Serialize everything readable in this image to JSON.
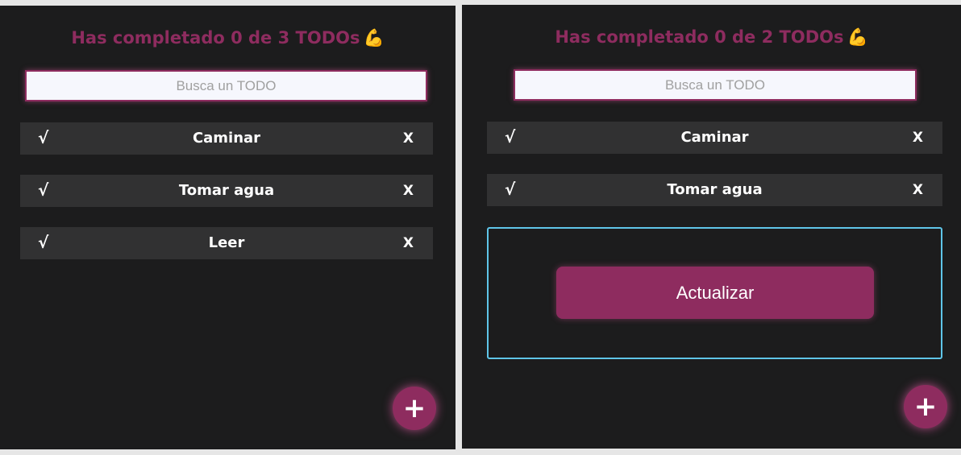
{
  "left": {
    "counter": "Has completado 0 de 3 TODOs",
    "counter_emoji": "💪",
    "search_placeholder": "Busca un TODO",
    "todos": [
      {
        "check": "√",
        "text": "Caminar",
        "delete": "X"
      },
      {
        "check": "√",
        "text": "Tomar agua",
        "delete": "X"
      },
      {
        "check": "√",
        "text": "Leer",
        "delete": "X"
      }
    ],
    "fab": "+"
  },
  "right": {
    "counter": "Has completado 0 de 2 TODOs",
    "counter_emoji": "💪",
    "search_placeholder": "Busca un TODO",
    "todos": [
      {
        "check": "√",
        "text": "Caminar",
        "delete": "X"
      },
      {
        "check": "√",
        "text": "Tomar agua",
        "delete": "X"
      }
    ],
    "update_button": "Actualizar",
    "fab": "+"
  },
  "colors": {
    "background": "#1c1c1d",
    "accent": "#8e2c5f",
    "todo_item": "#313132",
    "edit_border": "#5fc5e8",
    "search_bg": "#f6f7fd"
  }
}
